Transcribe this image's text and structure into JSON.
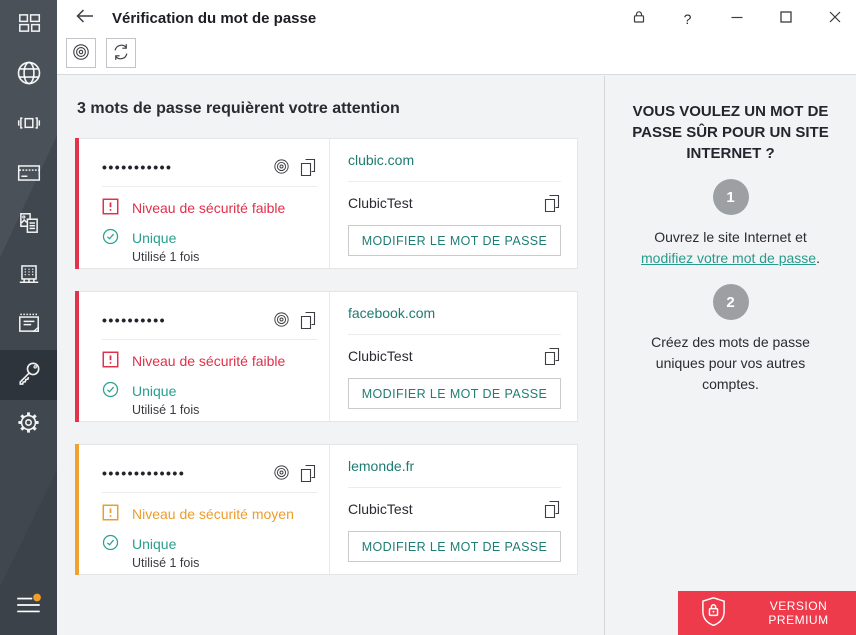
{
  "colors": {
    "accent_teal": "#27a08e",
    "link_teal": "#1e7b72",
    "danger_red": "#e2334b",
    "warning_orange": "#efa22f",
    "premium_red": "#ee3b4b",
    "sidebar_bg": "#41474f",
    "sidebar_selected_bg": "#2e343b",
    "main_bg": "#f2f3f4",
    "step_circle_gray": "#9da0a3"
  },
  "window": {
    "title": "Vérification du mot de passe",
    "help_glyph": "?"
  },
  "sidebar": {
    "items": [
      {
        "icon": "dashboard-icon"
      },
      {
        "icon": "globe-icon"
      },
      {
        "icon": "applications-icon"
      },
      {
        "icon": "bank-card-icon"
      },
      {
        "icon": "documents-icon"
      },
      {
        "icon": "addresses-icon"
      },
      {
        "icon": "notes-icon"
      },
      {
        "icon": "passwords-key-icon",
        "selected": true
      },
      {
        "icon": "settings-gear-icon"
      }
    ],
    "footer_icon": "menu-icon"
  },
  "toolbar": {
    "buttons": [
      {
        "icon": "eye-icon"
      },
      {
        "icon": "refresh-icon"
      }
    ]
  },
  "main": {
    "heading": "3 mots de passe requièrent votre attention",
    "cards": [
      {
        "severity": "faible",
        "password_mask": "•••••••••••",
        "security_label": "Niveau de sécurité faible",
        "unique_label": "Unique",
        "usage_label": "Utilisé 1 fois",
        "site": "clubic.com",
        "login": "ClubicTest",
        "action_label": "MODIFIER LE MOT DE PASSE"
      },
      {
        "severity": "faible",
        "password_mask": "••••••••••",
        "security_label": "Niveau de sécurité faible",
        "unique_label": "Unique",
        "usage_label": "Utilisé 1 fois",
        "site": "facebook.com",
        "login": "ClubicTest",
        "action_label": "MODIFIER LE MOT DE PASSE"
      },
      {
        "severity": "moyen",
        "password_mask": "•••••••••••••",
        "security_label": "Niveau de sécurité moyen",
        "unique_label": "Unique",
        "usage_label": "Utilisé 1 fois",
        "site": "lemonde.fr",
        "login": "ClubicTest",
        "action_label": "MODIFIER LE MOT DE PASSE"
      }
    ]
  },
  "aside": {
    "heading": "VOUS VOULEZ UN MOT DE PASSE SÛR POUR UN SITE INTERNET ?",
    "steps": [
      {
        "number": "1",
        "text": "Ouvrez le site Internet et",
        "link": "modifiez votre mot de passe",
        "suffix": "."
      },
      {
        "number": "2",
        "text": "Créez des mots de passe uniques pour vos autres comptes."
      }
    ],
    "premium": {
      "label": "VERSION PREMIUM"
    }
  }
}
